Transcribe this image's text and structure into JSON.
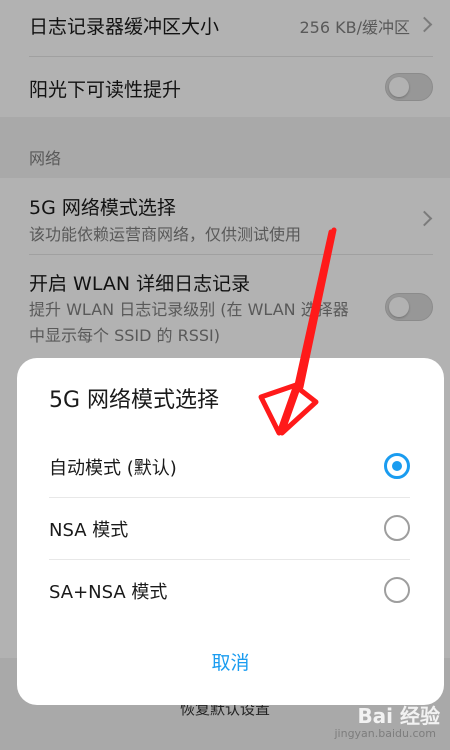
{
  "settings": {
    "log_buffer": {
      "title": "日志记录器缓冲区大小",
      "value": "256 KB/缓冲区"
    },
    "sunlight": {
      "title": "阳光下可读性提升",
      "enabled": false
    },
    "network_section": "网络",
    "mode_5g": {
      "title": "5G 网络模式选择",
      "subtitle": "该功能依赖运营商网络，仅供测试使用"
    },
    "wlan_log": {
      "title": "开启 WLAN 详细日志记录",
      "subtitle": "提升 WLAN 日志记录级别 (在 WLAN 选择器中显示每个 SSID 的 RSSI)",
      "enabled": false
    },
    "reset_label": "恢复默认设置"
  },
  "dialog": {
    "title": "5G 网络模式选择",
    "options": [
      {
        "label": "自动模式 (默认)",
        "selected": true
      },
      {
        "label": "NSA 模式",
        "selected": false
      },
      {
        "label": "SA+NSA 模式",
        "selected": false
      }
    ],
    "cancel_label": "取消"
  },
  "annotation": {
    "color": "#ff1a1a",
    "icon": "red-arrow-icon"
  },
  "watermark": {
    "text": "Bai 经验",
    "subtext": "jingyan.baidu.com"
  },
  "colors": {
    "accent": "#1a9cf0"
  }
}
